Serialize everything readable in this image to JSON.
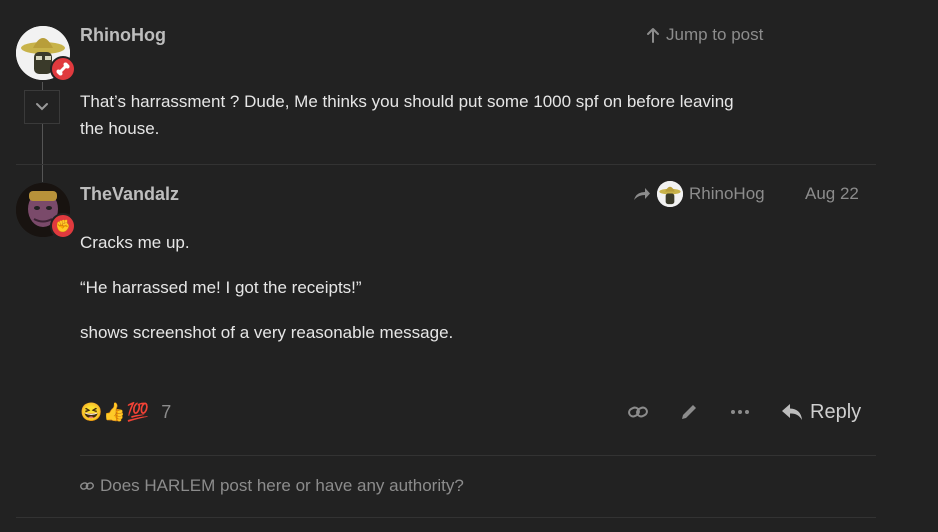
{
  "post_top": {
    "username": "RhinoHog",
    "jump_label": "Jump to post",
    "body_lines": [
      "That’s harrassment ? Dude, Me thinks you should put some 1000 spf on before leaving",
      "the house."
    ]
  },
  "post_main": {
    "username": "TheVandalz",
    "reply_to": "RhinoHog",
    "date": "Aug 22",
    "paragraphs": [
      "Cracks me up.",
      "“He harrassed me! I got the receipts!”",
      "shows screenshot of a very reasonable message."
    ],
    "reactions": {
      "emojis": [
        "😆",
        "👍",
        "💯"
      ],
      "count": "7"
    },
    "actions": {
      "reply_label": "Reply"
    }
  },
  "linked_topic": {
    "title": "Does HARLEM post here or have any authority?"
  },
  "colors": {
    "background": "#222222",
    "badge": "#e03a3e",
    "text": "#e6e6e6",
    "muted": "#8c8c8c"
  }
}
